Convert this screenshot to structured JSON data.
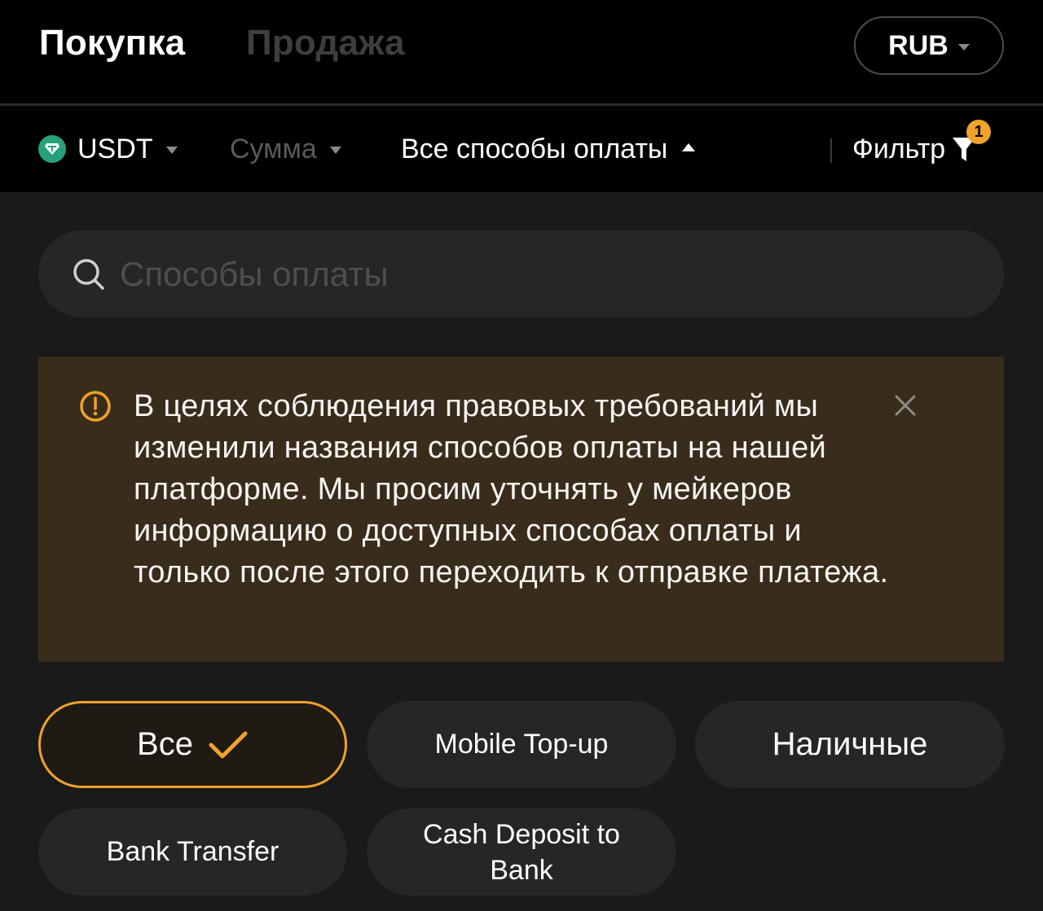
{
  "header": {
    "tabs": [
      {
        "label": "Покупка",
        "active": true
      },
      {
        "label": "Продажа",
        "active": false
      }
    ],
    "currency": {
      "label": "RUB",
      "icon": "caret-down-icon"
    }
  },
  "filters": {
    "coin": {
      "label": "USDT",
      "icon": "usdt-icon",
      "color": "#26a17b"
    },
    "amount": {
      "label": "Сумма"
    },
    "payment_methods": {
      "label": "Все способы оплаты",
      "expanded": true
    },
    "filter": {
      "label": "Фильтр",
      "badge": "1",
      "icon": "funnel-icon"
    }
  },
  "search": {
    "placeholder": "Способы оплаты",
    "value": ""
  },
  "notice": {
    "icon": "warning-circle-icon",
    "text": "В целях соблюдения правовых требований мы изменили названия способов оплаты на нашей платформе. Мы просим уточнять у мейкеров информацию о доступных способах оплаты и только после этого переходить к отправке платежа.",
    "background": "#3a2c1a"
  },
  "payment_chips": [
    {
      "label": "Все",
      "selected": true,
      "icon": "check-icon"
    },
    {
      "label": "Mobile Top-up",
      "selected": false
    },
    {
      "label": "Наличные",
      "selected": false
    },
    {
      "label": "Bank Transfer",
      "selected": false
    },
    {
      "label": "Cash Deposit to Bank",
      "selected": false
    }
  ],
  "colors": {
    "accent": "#f0a22a",
    "background": "#000000",
    "panel": "#1a1a1a",
    "chip": "#262626"
  }
}
